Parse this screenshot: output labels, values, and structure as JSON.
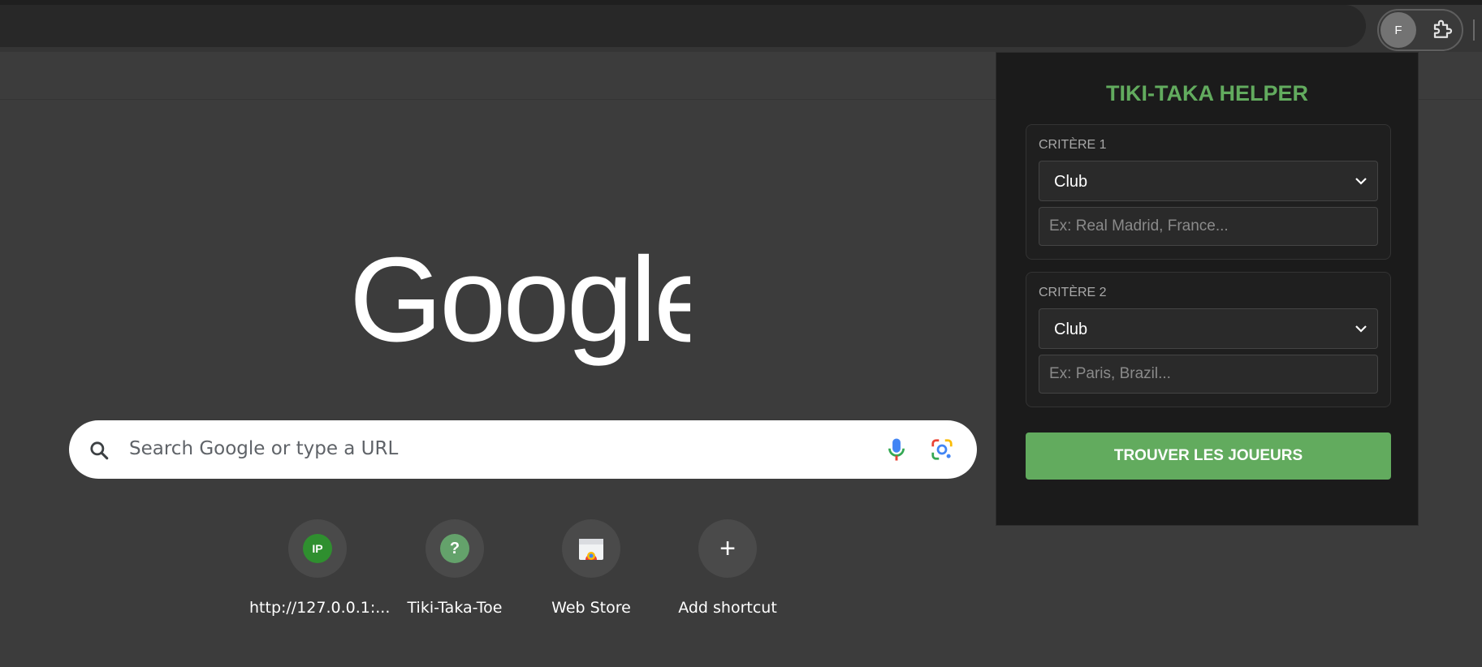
{
  "profile": {
    "initial": "F"
  },
  "search": {
    "placeholder": "Search Google or type a URL"
  },
  "shortcuts": [
    {
      "label": "http://127.0.0.1:...",
      "icon": "ip-site-icon",
      "badge": "IP"
    },
    {
      "label": "Tiki-Taka-Toe",
      "icon": "question-site-icon",
      "badge": "?"
    },
    {
      "label": "Web Store",
      "icon": "web-store-icon"
    },
    {
      "label": "Add shortcut",
      "icon": "plus-icon",
      "badge": "+"
    }
  ],
  "popup": {
    "title": "TIKI-TAKA HELPER",
    "criteria": [
      {
        "label": "CRITÈRE 1",
        "type_value": "Club",
        "placeholder": "Ex: Real Madrid, France..."
      },
      {
        "label": "CRITÈRE 2",
        "type_value": "Club",
        "placeholder": "Ex: Paris, Brazil..."
      }
    ],
    "button_label": "TROUVER LES JOUEURS"
  },
  "colors": {
    "accent_green": "#62ab5e",
    "page_bg": "#3c3c3c",
    "popup_bg": "#1b1b1b"
  }
}
